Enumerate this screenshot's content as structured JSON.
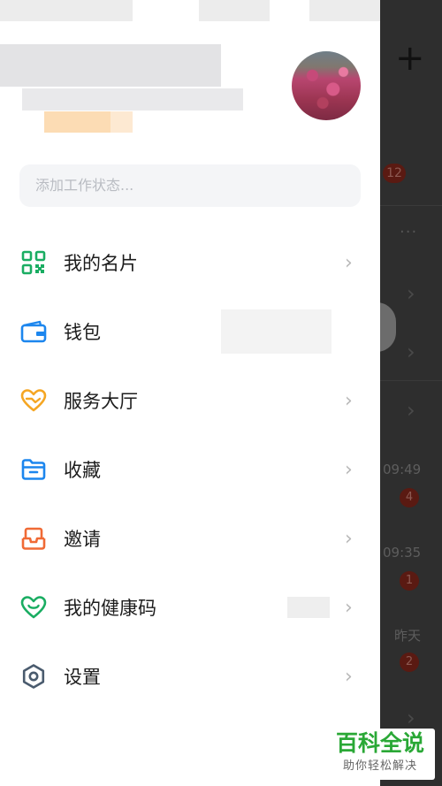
{
  "background": {
    "badge": "12",
    "dots": "···",
    "times": [
      "09:49",
      "09:35",
      "昨天"
    ],
    "counts": [
      "4",
      "1",
      "2"
    ]
  },
  "drawer": {
    "status_placeholder": "添加工作状态...",
    "menu": [
      {
        "label": "我的名片",
        "icon": "qr-code-icon",
        "color": "#1aad62"
      },
      {
        "label": "钱包",
        "icon": "wallet-icon",
        "color": "#1c86ee"
      },
      {
        "label": "服务大厅",
        "icon": "heart-hand-icon",
        "color": "#f5a623"
      },
      {
        "label": "收藏",
        "icon": "folder-icon",
        "color": "#1c86ee"
      },
      {
        "label": "邀请",
        "icon": "mailbox-icon",
        "color": "#f06a35"
      },
      {
        "label": "我的健康码",
        "icon": "health-heart-icon",
        "color": "#1aad62"
      },
      {
        "label": "设置",
        "icon": "gear-icon",
        "color": "#4a5b6e"
      }
    ]
  },
  "watermark": {
    "title": "百科全说",
    "subtitle": "助你轻松解决"
  }
}
